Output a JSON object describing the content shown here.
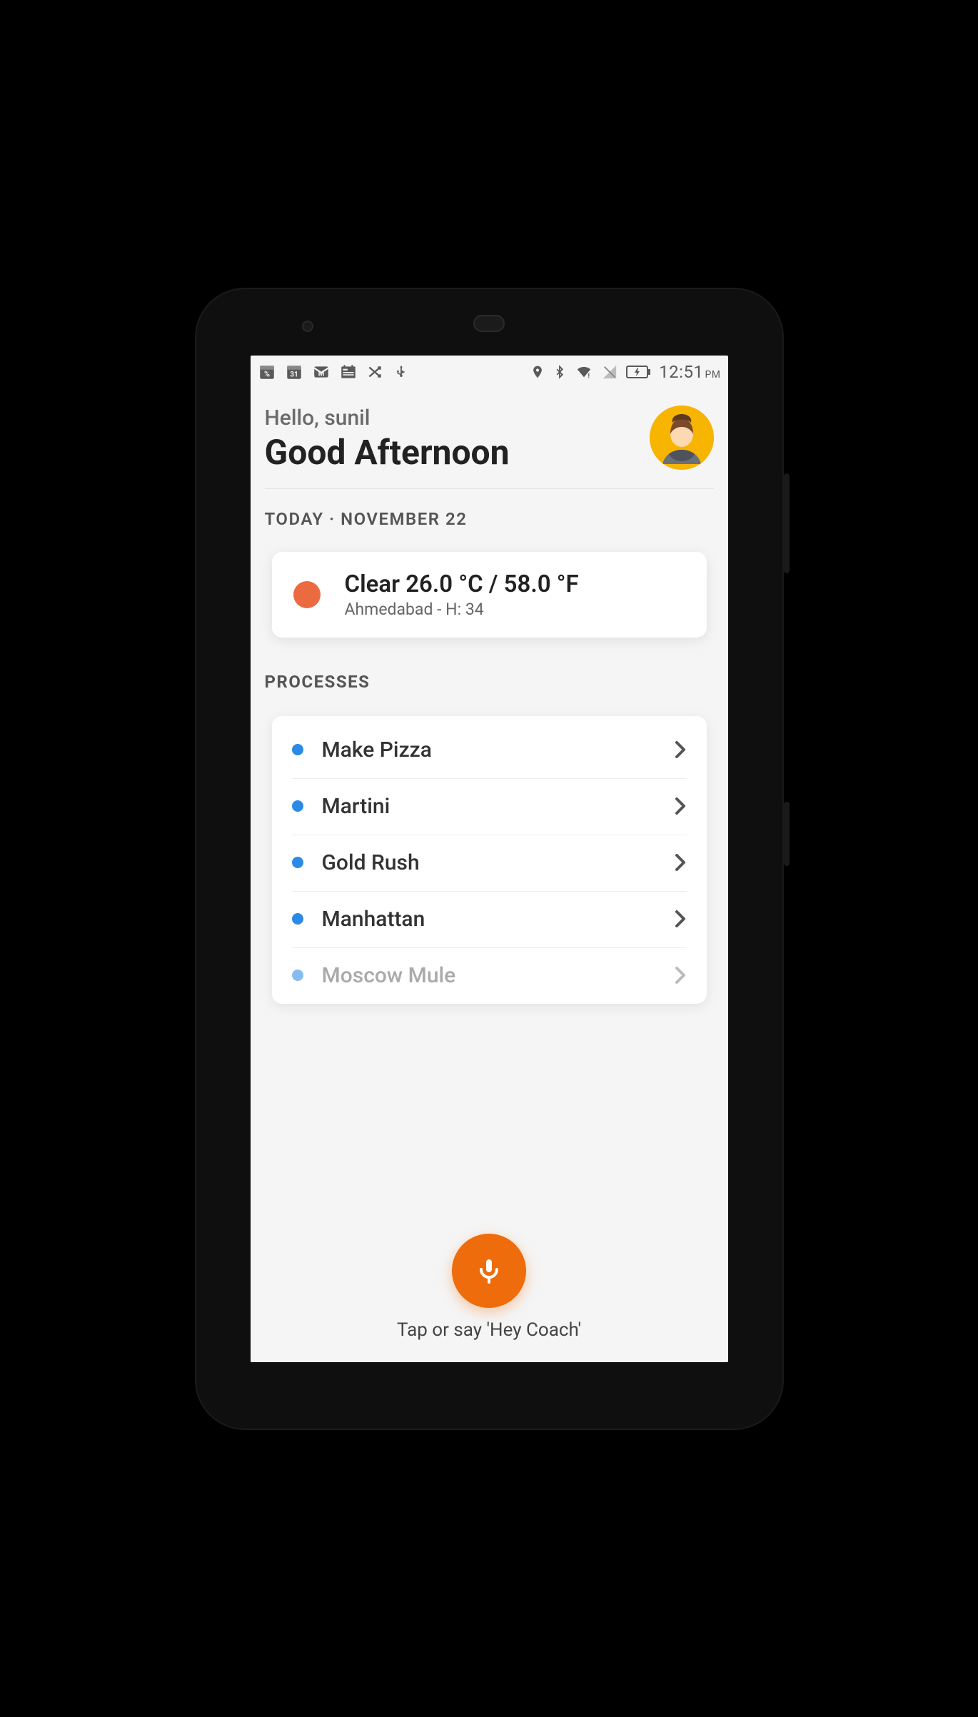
{
  "status_bar": {
    "time": "12:51",
    "ampm": "PM",
    "left_icons": [
      "calendar-sale-icon",
      "calendar-31-icon",
      "mail-icon",
      "news-icon",
      "crossed-arrows-icon",
      "usb-icon"
    ],
    "right_icons": [
      "location-icon",
      "bluetooth-icon",
      "wifi-icon",
      "sim-off-icon",
      "battery-charging-icon"
    ]
  },
  "greeting": {
    "hello": "Hello, sunil",
    "time_of_day": "Good Afternoon"
  },
  "date_line": "TODAY · NOVEMBER 22",
  "weather": {
    "headline": "Clear 26.0 °C / 58.0 °F",
    "subline": "Ahmedabad - H: 34"
  },
  "processes": {
    "title": "PROCESSES",
    "items": [
      {
        "label": "Make Pizza",
        "faded": false
      },
      {
        "label": "Martini",
        "faded": false
      },
      {
        "label": "Gold Rush",
        "faded": false
      },
      {
        "label": "Manhattan",
        "faded": false
      },
      {
        "label": "Moscow Mule",
        "faded": true
      }
    ]
  },
  "voice": {
    "hint": "Tap or say 'Hey Coach'"
  }
}
